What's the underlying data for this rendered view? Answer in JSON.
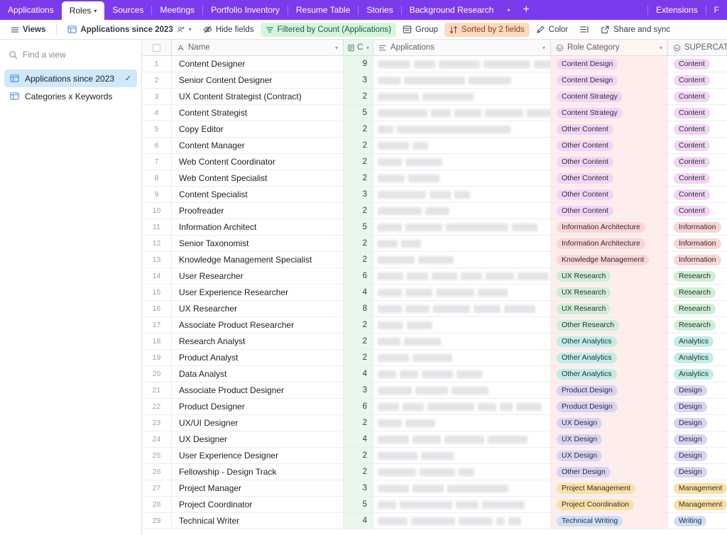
{
  "tabbar": {
    "tabs": [
      {
        "label": "Applications",
        "active": false,
        "chevron": false
      },
      {
        "label": "Roles",
        "active": true,
        "chevron": true
      },
      {
        "label": "Sources",
        "active": false,
        "chevron": false
      },
      {
        "label": "Meetings",
        "active": false,
        "chevron": false
      },
      {
        "label": "Portfolio Inventory",
        "active": false,
        "chevron": false
      },
      {
        "label": "Resume Table",
        "active": false,
        "chevron": false
      },
      {
        "label": "Stories",
        "active": false,
        "chevron": false
      },
      {
        "label": "Background Research",
        "active": false,
        "chevron": false
      }
    ],
    "overflow_chevron": "chevron-down-icon",
    "add_tab": "+",
    "right_items": [
      {
        "label": "Extensions"
      },
      {
        "label": "F"
      }
    ]
  },
  "toolbar": {
    "views_label": "Views",
    "view_name": "Applications since 2023",
    "hide_fields_label": "Hide fields",
    "filter_label": "Filtered by Count (Applications)",
    "group_label": "Group",
    "sort_label": "Sorted by 2 fields",
    "color_label": "Color",
    "row_height_label": "",
    "share_label": "Share and sync",
    "filter_color": "#d6f5dd",
    "sort_color": "#ffd9c4"
  },
  "sidebar": {
    "search_placeholder": "Find a view",
    "views": [
      {
        "label": "Applications since 2023",
        "active": true,
        "checked": true
      },
      {
        "label": "Categories x Keywords",
        "active": false,
        "checked": false
      }
    ]
  },
  "grid": {
    "columns": [
      {
        "key": "name",
        "label": "Name",
        "icon": "text-field-icon"
      },
      {
        "key": "count",
        "label": "C.",
        "icon": "count-field-icon"
      },
      {
        "key": "applications",
        "label": "Applications",
        "icon": "link-field-icon"
      },
      {
        "key": "role_category",
        "label": "Role Category",
        "icon": "select-field-icon"
      },
      {
        "key": "supercat",
        "label": "SUPERCAT",
        "icon": "select-field-icon"
      }
    ],
    "pill_colors": {
      "Content Design": "#f3d4f7",
      "Content Strategy": "#f3d4f7",
      "Other Content": "#f3d4f7",
      "Information Architecture": "#fbd4d4",
      "Knowledge Management": "#fbd4d4",
      "UX Research": "#cfeed4",
      "Other Research": "#cfeed4",
      "Other Analytics": "#bfeee6",
      "Product Design": "#d8d4f5",
      "UX Design": "#d8d4f5",
      "Other Design": "#d8d4f5",
      "Project Management": "#fbe0a6",
      "Project Coordination": "#fbe0a6",
      "Technical Writing": "#cfdefb",
      "Content": "#f3d4f7",
      "Information": "#fbd4d4",
      "Research": "#cfeed4",
      "Analytics": "#bfeee6",
      "Design": "#d8d4f5",
      "Management": "#fbe0a6",
      "Writing": "#cfdefb"
    },
    "rows": [
      {
        "n": 1,
        "name": "Content Designer",
        "count": 9,
        "apps": [
          46,
          30,
          58,
          66,
          43,
          50
        ],
        "role": "Content Design",
        "super": "Content"
      },
      {
        "n": 2,
        "name": "Senior Content Designer",
        "count": 3,
        "apps": [
          32,
          86,
          60
        ],
        "role": "Content Design",
        "super": "Content"
      },
      {
        "n": 3,
        "name": "UX Content Strategist (Contract)",
        "count": 2,
        "apps": [
          58,
          72
        ],
        "role": "Content Strategy",
        "super": "Content"
      },
      {
        "n": 4,
        "name": "Content Strategist",
        "count": 5,
        "apps": [
          70,
          28,
          38,
          54,
          40
        ],
        "role": "Content Strategy",
        "super": "Content"
      },
      {
        "n": 5,
        "name": "Copy Editor",
        "count": 2,
        "apps": [
          22,
          160
        ],
        "role": "Other Content",
        "super": "Content"
      },
      {
        "n": 6,
        "name": "Content Manager",
        "count": 2,
        "apps": [
          44,
          22
        ],
        "role": "Other Content",
        "super": "Content"
      },
      {
        "n": 7,
        "name": "Web Content Coordinator",
        "count": 2,
        "apps": [
          34,
          52
        ],
        "role": "Other Content",
        "super": "Content"
      },
      {
        "n": 8,
        "name": "Web Content Specialist",
        "count": 2,
        "apps": [
          38,
          44
        ],
        "role": "Other Content",
        "super": "Content"
      },
      {
        "n": 9,
        "name": "Content Specialist",
        "count": 3,
        "apps": [
          68,
          30,
          22
        ],
        "role": "Other Content",
        "super": "Content"
      },
      {
        "n": 10,
        "name": "Proofreader",
        "count": 2,
        "apps": [
          62,
          34
        ],
        "role": "Other Content",
        "super": "Content"
      },
      {
        "n": 11,
        "name": "Information Architect",
        "count": 5,
        "apps": [
          34,
          52,
          88,
          36
        ],
        "role": "Information Architecture",
        "super": "Information"
      },
      {
        "n": 12,
        "name": "Senior Taxonomist",
        "count": 2,
        "apps": [
          28,
          28
        ],
        "role": "Information Architecture",
        "super": "Information"
      },
      {
        "n": 13,
        "name": "Knowledge Management Specialist",
        "count": 2,
        "apps": [
          52,
          50
        ],
        "role": "Knowledge Management",
        "super": "Information"
      },
      {
        "n": 14,
        "name": "User Researcher",
        "count": 6,
        "apps": [
          36,
          30,
          36,
          30,
          40,
          44
        ],
        "role": "UX Research",
        "super": "Research"
      },
      {
        "n": 15,
        "name": "User Experience Researcher",
        "count": 4,
        "apps": [
          34,
          38,
          54,
          42
        ],
        "role": "UX Research",
        "super": "Research"
      },
      {
        "n": 16,
        "name": "UX Researcher",
        "count": 8,
        "apps": [
          34,
          34,
          52,
          38,
          44
        ],
        "role": "UX Research",
        "super": "Research"
      },
      {
        "n": 17,
        "name": "Associate Product Researcher",
        "count": 2,
        "apps": [
          36,
          36
        ],
        "role": "Other Research",
        "super": "Research"
      },
      {
        "n": 18,
        "name": "Research Analyst",
        "count": 2,
        "apps": [
          32,
          52
        ],
        "role": "Other Analytics",
        "super": "Analytics"
      },
      {
        "n": 19,
        "name": "Product Analyst",
        "count": 2,
        "apps": [
          44,
          56
        ],
        "role": "Other Analytics",
        "super": "Analytics"
      },
      {
        "n": 20,
        "name": "Data Analyst",
        "count": 4,
        "apps": [
          26,
          26,
          44,
          36
        ],
        "role": "Other Analytics",
        "super": "Analytics"
      },
      {
        "n": 21,
        "name": "Associate Product Designer",
        "count": 3,
        "apps": [
          48,
          46,
          52
        ],
        "role": "Product Design",
        "super": "Design"
      },
      {
        "n": 22,
        "name": "Product Designer",
        "count": 6,
        "apps": [
          30,
          30,
          66,
          26,
          18,
          36
        ],
        "role": "Product Design",
        "super": "Design"
      },
      {
        "n": 23,
        "name": "UX/UI Designer",
        "count": 2,
        "apps": [
          34,
          42
        ],
        "role": "UX Design",
        "super": "Design"
      },
      {
        "n": 24,
        "name": "UX Designer",
        "count": 4,
        "apps": [
          44,
          40,
          56,
          56
        ],
        "role": "UX Design",
        "super": "Design"
      },
      {
        "n": 25,
        "name": "User Experience Designer",
        "count": 2,
        "apps": [
          56,
          46
        ],
        "role": "UX Design",
        "super": "Design"
      },
      {
        "n": 26,
        "name": "Fellowship - Design Track",
        "count": 2,
        "apps": [
          54,
          50,
          22
        ],
        "role": "Other Design",
        "super": "Design"
      },
      {
        "n": 27,
        "name": "Project Manager",
        "count": 3,
        "apps": [
          44,
          44,
          86
        ],
        "role": "Project Management",
        "super": "Management"
      },
      {
        "n": 28,
        "name": "Project Coordinator",
        "count": 5,
        "apps": [
          26,
          74,
          32,
          60
        ],
        "role": "Project Coordination",
        "super": "Management"
      },
      {
        "n": 29,
        "name": "Technical Writer",
        "count": 4,
        "apps": [
          42,
          62,
          48,
          12,
          18
        ],
        "role": "Technical Writing",
        "super": "Writing"
      }
    ]
  }
}
